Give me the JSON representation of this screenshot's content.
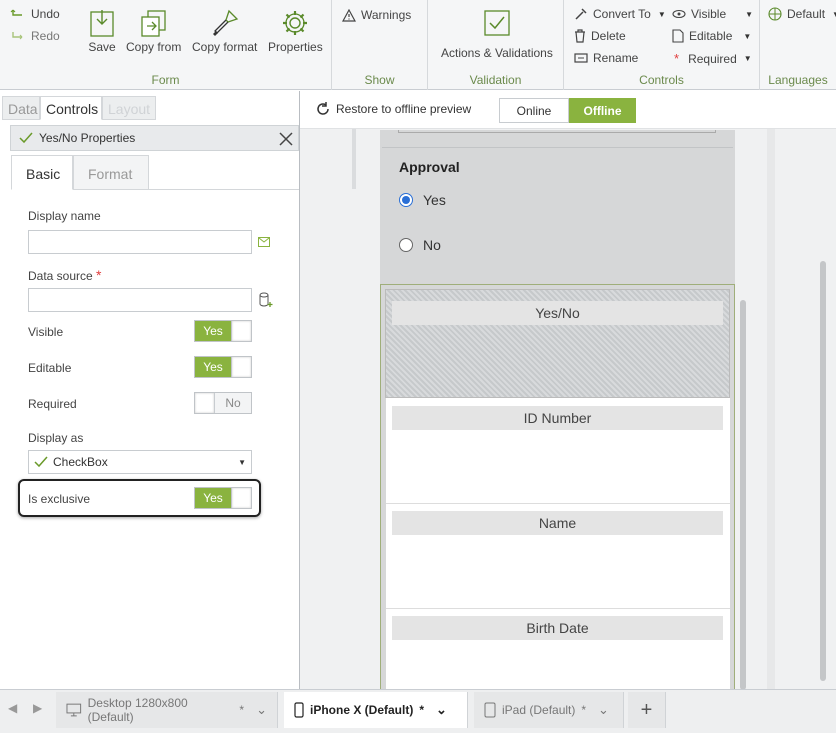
{
  "ribbon": {
    "undo": "Undo",
    "redo": "Redo",
    "save": "Save",
    "copy_from": "Copy from",
    "copy_format": "Copy format",
    "properties": "Properties",
    "group_form": "Form",
    "warnings": "Warnings",
    "group_show": "Show",
    "actions_validations": "Actions & Validations",
    "group_validation": "Validation",
    "convert_to": "Convert To",
    "delete": "Delete",
    "rename": "Rename",
    "visible": "Visible",
    "editable": "Editable",
    "required": "Required",
    "group_controls": "Controls",
    "default": "Default",
    "group_languages": "Languages"
  },
  "left_panel": {
    "tabs": [
      "Data",
      "Controls",
      "Layout"
    ],
    "header_title": "Yes/No Properties",
    "subtabs": [
      "Basic",
      "Format"
    ],
    "display_name_label": "Display name",
    "display_name_value": "",
    "data_source_label": "Data source",
    "required_star": "*",
    "data_source_value": "",
    "visible_label": "Visible",
    "visible_value": "Yes",
    "editable_label": "Editable",
    "editable_value": "Yes",
    "required_label": "Required",
    "required_value": "No",
    "display_as_label": "Display as",
    "display_as_value": "CheckBox",
    "exclusive_label": "Is exclusive",
    "exclusive_value": "Yes"
  },
  "canvas": {
    "restore_label": "Restore to offline preview",
    "online_label": "Online",
    "offline_label": "Offline",
    "approval_title": "Approval",
    "option_yes": "Yes",
    "option_no": "No",
    "sections": [
      "Yes/No",
      "ID Number",
      "Name",
      "Birth Date"
    ]
  },
  "device_tabs": [
    {
      "label": "Desktop 1280x800 (Default)",
      "mark": "*"
    },
    {
      "label": "iPhone X (Default)",
      "mark": "*"
    },
    {
      "label": "iPad (Default)",
      "mark": "*"
    }
  ],
  "colors": {
    "accent_green": "#8ab33f",
    "group_label_green": "#6b8a4c",
    "required_red": "#e03c3c"
  }
}
